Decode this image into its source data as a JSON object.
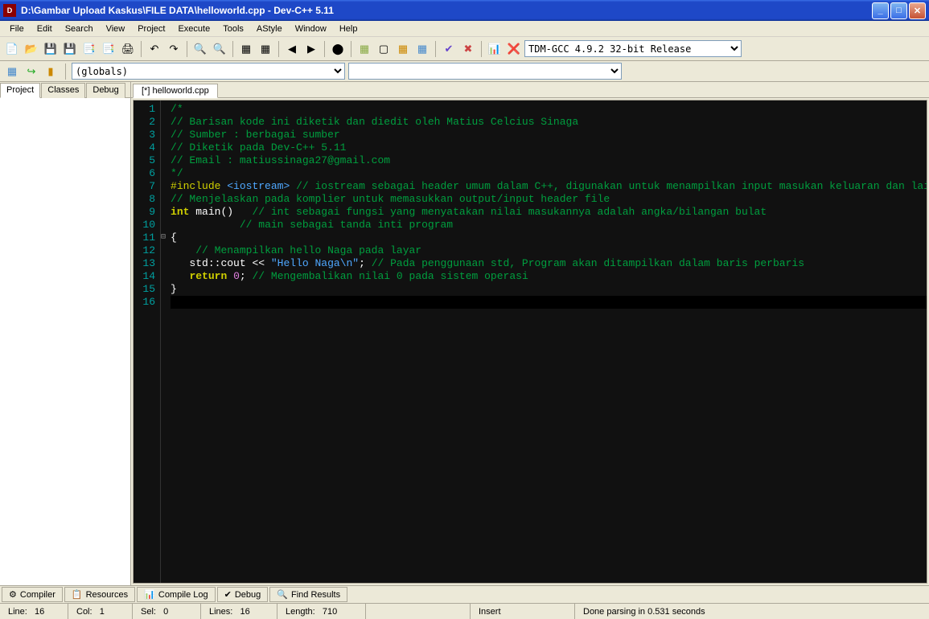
{
  "window": {
    "title": "D:\\Gambar Upload Kaskus\\FILE DATA\\helloworld.cpp - Dev-C++ 5.11"
  },
  "menu": [
    "File",
    "Edit",
    "Search",
    "View",
    "Project",
    "Execute",
    "Tools",
    "AStyle",
    "Window",
    "Help"
  ],
  "compiler_select": "TDM-GCC 4.9.2 32-bit Release",
  "scope_select": "(globals)",
  "left_tabs": [
    "Project",
    "Classes",
    "Debug"
  ],
  "left_active": "Project",
  "file_tabs": [
    "[*] helloworld.cpp"
  ],
  "file_active": "[*] helloworld.cpp",
  "code_lines": [
    {
      "n": 1,
      "segs": [
        {
          "t": "/*",
          "c": "cmt"
        }
      ]
    },
    {
      "n": 2,
      "segs": [
        {
          "t": "// Barisan kode ini diketik dan diedit oleh Matius Celcius Sinaga",
          "c": "cmt"
        }
      ]
    },
    {
      "n": 3,
      "segs": [
        {
          "t": "// Sumber : berbagai sumber",
          "c": "cmt"
        }
      ]
    },
    {
      "n": 4,
      "segs": [
        {
          "t": "// Diketik pada Dev-C++ 5.11",
          "c": "cmt"
        }
      ]
    },
    {
      "n": 5,
      "segs": [
        {
          "t": "// Email : matiussinaga27@gmail.com",
          "c": "cmt"
        }
      ]
    },
    {
      "n": 6,
      "segs": [
        {
          "t": "*/",
          "c": "cmt"
        }
      ]
    },
    {
      "n": 7,
      "segs": [
        {
          "t": "#include ",
          "c": "pp"
        },
        {
          "t": "<iostream>",
          "c": "inc"
        },
        {
          "t": " // iostream sebagai header umum dalam C++, digunakan untuk menampilkan input masukan keluaran dan lainnya",
          "c": "cmt"
        }
      ]
    },
    {
      "n": 8,
      "segs": [
        {
          "t": "// Menjelaskan pada komplier untuk memasukkan output/input header file",
          "c": "cmt"
        }
      ]
    },
    {
      "n": 9,
      "segs": [
        {
          "t": "int",
          "c": "kw"
        },
        {
          "t": " main()   ",
          "c": "id"
        },
        {
          "t": "// int sebagai fungsi yang menyatakan nilai masukannya adalah angka/bilangan bulat",
          "c": "cmt"
        }
      ]
    },
    {
      "n": 10,
      "segs": [
        {
          "t": "           ",
          "c": "id"
        },
        {
          "t": "// main sebagai tanda inti program",
          "c": "cmt"
        }
      ]
    },
    {
      "n": 11,
      "segs": [
        {
          "t": "{",
          "c": "id"
        }
      ],
      "fold": "⊟"
    },
    {
      "n": 12,
      "segs": [
        {
          "t": "    ",
          "c": "id"
        },
        {
          "t": "// Menampilkan hello Naga pada layar",
          "c": "cmt"
        }
      ]
    },
    {
      "n": 13,
      "segs": [
        {
          "t": "   std",
          "c": "id"
        },
        {
          "t": "::",
          "c": "id"
        },
        {
          "t": "cout ",
          "c": "id"
        },
        {
          "t": "<< ",
          "c": "id"
        },
        {
          "t": "\"Hello Naga\\n\"",
          "c": "str"
        },
        {
          "t": "; ",
          "c": "id"
        },
        {
          "t": "// Pada penggunaan std, Program akan ditampilkan dalam baris perbaris",
          "c": "cmt"
        }
      ]
    },
    {
      "n": 14,
      "segs": [
        {
          "t": "   ",
          "c": "id"
        },
        {
          "t": "return",
          "c": "kw"
        },
        {
          "t": " ",
          "c": "id"
        },
        {
          "t": "0",
          "c": "num"
        },
        {
          "t": "; ",
          "c": "id"
        },
        {
          "t": "// Mengembalikan nilai 0 pada sistem operasi",
          "c": "cmt"
        }
      ]
    },
    {
      "n": 15,
      "segs": [
        {
          "t": "}",
          "c": "id"
        }
      ]
    },
    {
      "n": 16,
      "segs": [
        {
          "t": "",
          "c": "id"
        }
      ],
      "current": true
    }
  ],
  "bottom_tabs": [
    {
      "icon": "⚙",
      "label": "Compiler"
    },
    {
      "icon": "📋",
      "label": "Resources"
    },
    {
      "icon": "📊",
      "label": "Compile Log"
    },
    {
      "icon": "✔",
      "label": "Debug"
    },
    {
      "icon": "🔍",
      "label": "Find Results"
    }
  ],
  "status": {
    "line_label": "Line:",
    "line_val": "16",
    "col_label": "Col:",
    "col_val": "1",
    "sel_label": "Sel:",
    "sel_val": "0",
    "lines_label": "Lines:",
    "lines_val": "16",
    "length_label": "Length:",
    "length_val": "710",
    "insert": "Insert",
    "parse": "Done parsing in 0.531 seconds"
  },
  "toolbar_icons": [
    {
      "g": "📄",
      "n": "new-file"
    },
    {
      "g": "📂",
      "n": "open-file"
    },
    {
      "g": "💾",
      "n": "save-file"
    },
    {
      "g": "💾",
      "n": "save-all"
    },
    {
      "g": "📑",
      "n": "save-as"
    },
    {
      "g": "📑",
      "n": "close"
    },
    {
      "g": "🖨",
      "n": "print"
    },
    {
      "sep": true
    },
    {
      "g": "↶",
      "n": "undo"
    },
    {
      "g": "↷",
      "n": "redo"
    },
    {
      "sep": true
    },
    {
      "g": "🔍",
      "n": "find"
    },
    {
      "g": "🔍",
      "n": "replace"
    },
    {
      "sep": true
    },
    {
      "g": "▦",
      "n": "compile"
    },
    {
      "g": "▦",
      "n": "run"
    },
    {
      "sep": true
    },
    {
      "g": "◀",
      "n": "back"
    },
    {
      "g": "▶",
      "n": "forward"
    },
    {
      "sep": true
    },
    {
      "g": "⬤",
      "n": "stop"
    },
    {
      "sep": true
    },
    {
      "g": "▦",
      "n": "compile-run",
      "col": "#8a4"
    },
    {
      "g": "▢",
      "n": "rebuild"
    },
    {
      "g": "▦",
      "n": "syntax-check",
      "col": "#c80"
    },
    {
      "g": "▦",
      "n": "clean",
      "col": "#48c"
    },
    {
      "sep": true
    },
    {
      "g": "✔",
      "n": "debug",
      "col": "#64c"
    },
    {
      "g": "✖",
      "n": "stop-debug",
      "col": "#c44"
    },
    {
      "sep": true
    },
    {
      "g": "📊",
      "n": "profile"
    },
    {
      "g": "❌",
      "n": "delete-profile"
    }
  ],
  "toolbar2_icons": [
    {
      "g": "▦",
      "n": "new-class",
      "col": "#48c"
    },
    {
      "g": "↪",
      "n": "goto-impl",
      "col": "#2a2"
    },
    {
      "g": "▮",
      "n": "bookmark",
      "col": "#c80"
    }
  ]
}
